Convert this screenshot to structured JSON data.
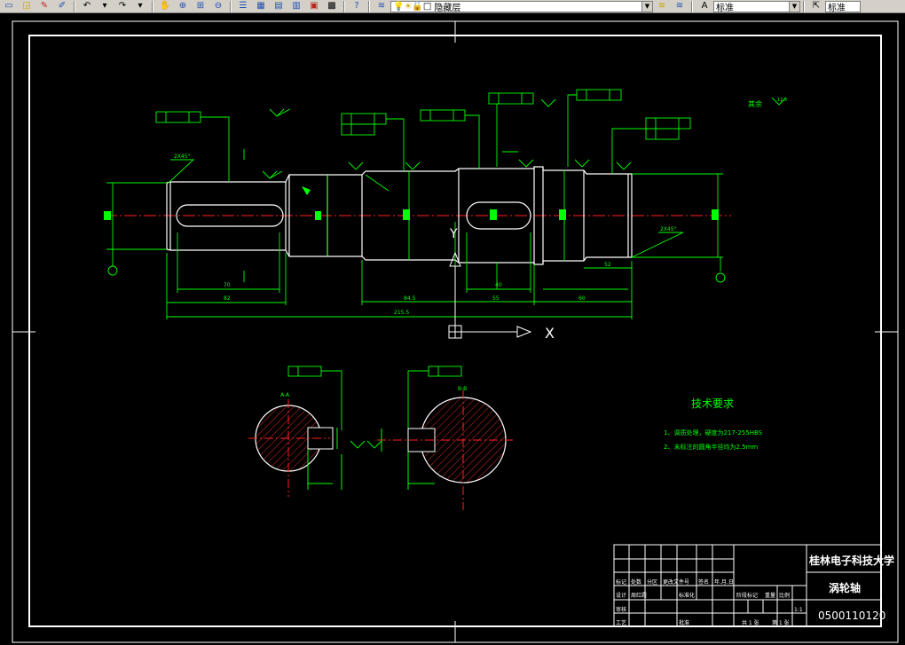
{
  "toolbar": {
    "layer_name": "隐藏层",
    "text_style": "标准",
    "dim_style": "标准"
  },
  "drawing": {
    "surface_note": "其余",
    "surface_roughness": "12.5",
    "tech_title": "技术要求",
    "tech_req_1": "1、调质处理，硬度为217-255HBS",
    "tech_req_2": "2、未标注的圆角半径均为2.5mm",
    "university": "桂林电子科技大学",
    "part_name": "涡轮轴",
    "drawing_number": "0500110120",
    "scale": "1:1",
    "sheet_total": "共 1 张",
    "sheet_no": "第 1 张",
    "chamfer_left": "2X45°",
    "chamfer_right": "2X45°",
    "dim_total": "215.5",
    "dim_84_5": "84.5",
    "dim_70": "70",
    "dim_82": "82",
    "dim_60": "60",
    "dim_55": "55",
    "dim_40": "40",
    "dim_52": "52",
    "section_a": "A-A",
    "section_b": "B-B",
    "ucs_x": "X",
    "ucs_y": "Y",
    "title_block": {
      "mark": "标记",
      "count": "处数",
      "zone": "分区",
      "change_doc": "更改文件号",
      "sign": "签名",
      "date": "年.月.日",
      "designer": "设计",
      "designer_name": "周红霞",
      "review": "审核",
      "engineer": "工艺",
      "approve": "批准",
      "std": "标准化",
      "stage": "阶段标记",
      "weight": "重量",
      "ratio": "比例"
    }
  }
}
